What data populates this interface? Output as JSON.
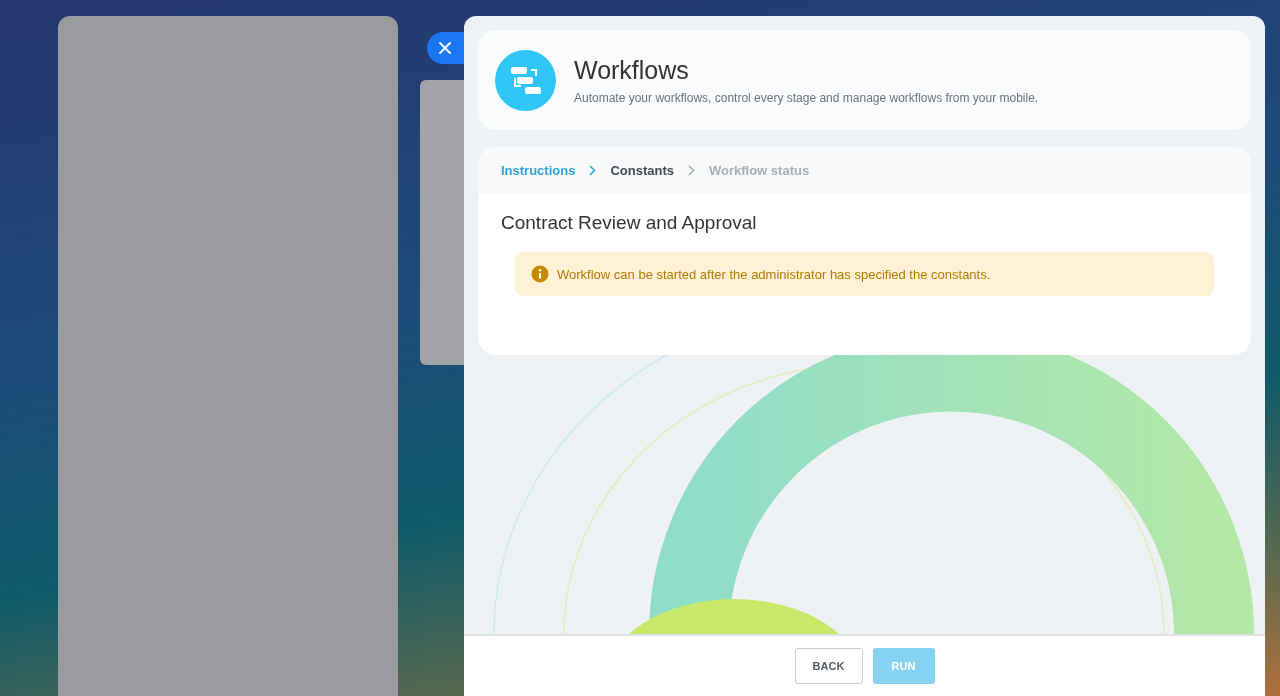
{
  "header": {
    "title": "Workflows",
    "subtitle": "Automate your workflows, control every stage and manage workflows from your mobile."
  },
  "steps": [
    {
      "label": "Instructions",
      "completed": true,
      "selected": false
    },
    {
      "label": "Constants",
      "completed": false,
      "selected": true
    },
    {
      "label": "Workflow status",
      "completed": false,
      "selected": false
    }
  ],
  "workflow": {
    "title": "Contract Review and Approval",
    "notice": "Workflow can be started after the administrator has specified the constants."
  },
  "buttons": [
    {
      "label": "BACK",
      "disabled": false
    },
    {
      "label": "RUN",
      "disabled": true
    }
  ]
}
